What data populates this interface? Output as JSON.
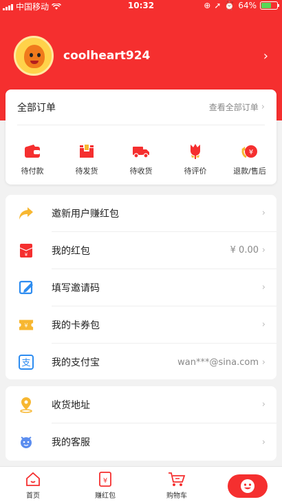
{
  "status_bar": {
    "carrier": "中国移动",
    "time": "10:32",
    "battery": "64%"
  },
  "profile": {
    "username": "coolheart924"
  },
  "orders": {
    "title": "全部订单",
    "view_all": "查看全部订单",
    "items": [
      {
        "label": "待付款",
        "icon": "wallet-icon"
      },
      {
        "label": "待发货",
        "icon": "package-icon"
      },
      {
        "label": "待收货",
        "icon": "truck-icon"
      },
      {
        "label": "待评价",
        "icon": "flower-icon"
      },
      {
        "label": "退款/售后",
        "icon": "refund-icon"
      }
    ]
  },
  "menu_group_1": [
    {
      "title": "邀新用户赚红包",
      "value": "",
      "icon": "share-arrow-icon"
    },
    {
      "title": "我的红包",
      "value": "¥ 0.00",
      "icon": "red-envelope-icon"
    },
    {
      "title": "填写邀请码",
      "value": "",
      "icon": "edit-code-icon"
    },
    {
      "title": "我的卡券包",
      "value": "",
      "icon": "coupon-icon"
    },
    {
      "title": "我的支付宝",
      "value": "wan***@sina.com",
      "icon": "alipay-icon"
    }
  ],
  "menu_group_2": [
    {
      "title": "收货地址",
      "value": "",
      "icon": "location-pin-icon"
    },
    {
      "title": "我的客服",
      "value": "",
      "icon": "customer-service-icon"
    }
  ],
  "tabbar": {
    "tabs": [
      {
        "label": "首页",
        "icon": "home-icon"
      },
      {
        "label": "赚红包",
        "icon": "red-packet-icon"
      },
      {
        "label": "购物车",
        "icon": "cart-icon"
      }
    ],
    "active_icon": "smiley-icon"
  },
  "colors": {
    "brand_red": "#f52f2f",
    "accent_orange": "#f7b731",
    "alipay_blue": "#2d8cf0"
  }
}
